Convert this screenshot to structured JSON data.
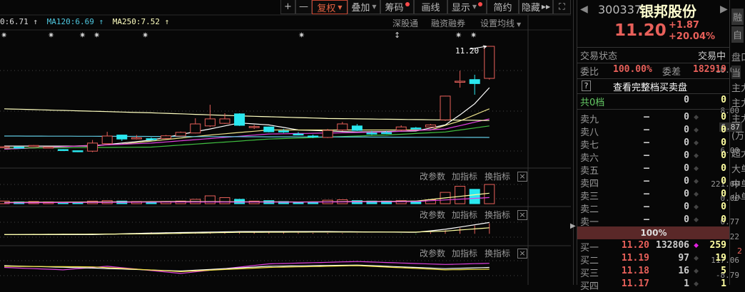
{
  "toolbar": {
    "zoom_in": "+",
    "zoom_out": "—",
    "fuquan": "复权",
    "diejia": "叠加",
    "chouma": "筹码",
    "huaxian": "画线",
    "xianshi": "显示",
    "jianyue": "简约",
    "yincang": "隐藏"
  },
  "ma_legend": [
    {
      "text": "0:6.71 ↑",
      "color": "#dddddd"
    },
    {
      "text": "MA120:6.69 ↑",
      "color": "#4fc8e0"
    },
    {
      "text": "MA250:7.52 ↑",
      "color": "#ffffc0"
    }
  ],
  "links": {
    "shengutong": "深股通",
    "rongzi": "融资融券",
    "shezhi": "设置均线"
  },
  "markers": "✷",
  "panel_tools": {
    "param": "改参数",
    "add": "加指标",
    "switch": "换指标",
    "close": "×"
  },
  "axes": {
    "main": [
      "10.00",
      "8.00",
      "6.00"
    ],
    "current": "6.87",
    "volume": [
      "221.00",
      "0.00"
    ],
    "macd": [
      "0.77",
      "-0.22"
    ],
    "ind3": [
      "117.06",
      "-8.79"
    ]
  },
  "last_price_label": "11.20",
  "colors": {
    "up": "#e8605a",
    "down": "#2ae8f0",
    "ma5": "#ffffff",
    "ma10": "#f0e68c",
    "ma20": "#e040e0",
    "ma60": "#40c040",
    "ma120": "#60c8e0",
    "ma250": "#ffffc0"
  },
  "chart_data": {
    "type": "candlestick",
    "ylim": [
      5.6,
      11.5
    ],
    "ohlc": [
      [
        6.2,
        6.22,
        6.25,
        6.18
      ],
      [
        6.2,
        6.18,
        6.22,
        6.15
      ],
      [
        6.22,
        6.28,
        6.3,
        6.2
      ],
      [
        6.18,
        6.2,
        6.22,
        6.15
      ],
      [
        6.08,
        6.03,
        6.1,
        6.0
      ],
      [
        6.02,
        5.98,
        6.03,
        5.95
      ],
      [
        6.0,
        6.4,
        6.55,
        5.95
      ],
      [
        6.37,
        6.75,
        6.96,
        6.33
      ],
      [
        6.8,
        6.6,
        6.82,
        6.5
      ],
      [
        6.64,
        6.66,
        6.8,
        6.58
      ],
      [
        6.62,
        6.6,
        6.68,
        6.55
      ],
      [
        6.63,
        6.76,
        6.8,
        6.6
      ],
      [
        6.75,
        6.93,
        6.97,
        6.72
      ],
      [
        6.9,
        7.35,
        7.63,
        6.88
      ],
      [
        7.25,
        7.6,
        8.3,
        7.2
      ],
      [
        7.38,
        7.6,
        7.88,
        7.35
      ],
      [
        7.85,
        7.28,
        7.88,
        7.25
      ],
      [
        7.18,
        7.22,
        7.3,
        7.1
      ],
      [
        7.2,
        6.96,
        7.22,
        6.93
      ],
      [
        7.0,
        6.98,
        7.1,
        6.9
      ],
      [
        6.85,
        6.83,
        6.95,
        6.78
      ],
      [
        6.75,
        6.73,
        6.82,
        6.65
      ],
      [
        6.68,
        7.03,
        7.1,
        6.65
      ],
      [
        7.05,
        7.35,
        7.45,
        7.0
      ],
      [
        7.25,
        7.03,
        7.35,
        7.0
      ],
      [
        6.9,
        6.88,
        7.0,
        6.8
      ],
      [
        6.92,
        6.9,
        7.0,
        6.85
      ],
      [
        7.05,
        7.2,
        7.28,
        7.0
      ],
      [
        7.15,
        7.12,
        7.2,
        7.08
      ],
      [
        7.2,
        7.3,
        7.35,
        7.15
      ],
      [
        7.55,
        8.73,
        8.75,
        7.5
      ],
      [
        9.45,
        9.47,
        9.99,
        9.15
      ],
      [
        9.55,
        9.35,
        9.79,
        8.8
      ],
      [
        9.61,
        11.2,
        11.2,
        9.55
      ]
    ],
    "ma": [
      {
        "name": "MA5",
        "color": "#ffffff",
        "pts": [
          [
            0,
            6.25
          ],
          [
            6,
            6.25
          ],
          [
            10,
            6.55
          ],
          [
            14,
            7.1
          ],
          [
            16,
            7.4
          ],
          [
            18,
            7.3
          ],
          [
            20,
            7.05
          ],
          [
            24,
            6.95
          ],
          [
            28,
            7.0
          ],
          [
            30,
            7.3
          ],
          [
            31,
            7.8
          ],
          [
            32,
            8.35
          ],
          [
            33,
            9.15
          ]
        ]
      },
      {
        "name": "MA10",
        "color": "#f0e68c",
        "pts": [
          [
            0,
            6.1
          ],
          [
            8,
            6.35
          ],
          [
            14,
            6.8
          ],
          [
            18,
            7.05
          ],
          [
            24,
            7.05
          ],
          [
            29,
            7.05
          ],
          [
            31,
            7.5
          ],
          [
            33,
            8.1
          ]
        ]
      },
      {
        "name": "MA20",
        "color": "#e040e0",
        "pts": [
          [
            0,
            6.1
          ],
          [
            10,
            6.4
          ],
          [
            18,
            6.85
          ],
          [
            26,
            6.95
          ],
          [
            30,
            7.1
          ],
          [
            33,
            7.6
          ]
        ]
      },
      {
        "name": "MA60",
        "color": "#40c040",
        "pts": [
          [
            0,
            6.15
          ],
          [
            10,
            6.2
          ],
          [
            18,
            6.6
          ],
          [
            26,
            6.8
          ],
          [
            30,
            6.95
          ],
          [
            33,
            7.25
          ]
        ]
      },
      {
        "name": "MA120",
        "color": "#60c8e0",
        "pts": [
          [
            0,
            6.75
          ],
          [
            33,
            6.68
          ]
        ]
      },
      {
        "name": "MA250",
        "color": "#ffffc0",
        "pts": [
          [
            0,
            8.1
          ],
          [
            5,
            8.0
          ],
          [
            10,
            7.9
          ],
          [
            16,
            7.75
          ],
          [
            22,
            7.62
          ],
          [
            33,
            7.52
          ]
        ]
      }
    ],
    "volume": [
      30,
      20,
      25,
      20,
      15,
      15,
      30,
      35,
      30,
      25,
      20,
      25,
      30,
      50,
      90,
      70,
      50,
      30,
      35,
      25,
      20,
      15,
      40,
      45,
      35,
      30,
      30,
      35,
      30,
      45,
      130,
      200,
      165,
      221
    ],
    "volume_ylim": [
      0,
      221
    ],
    "macd": {
      "ylim": [
        -0.22,
        0.77
      ],
      "dif": [
        [
          0,
          -0.05
        ],
        [
          6,
          -0.05
        ],
        [
          10,
          0.05
        ],
        [
          16,
          0.15
        ],
        [
          22,
          0.15
        ],
        [
          28,
          0.1
        ],
        [
          30,
          0.3
        ],
        [
          33,
          0.75
        ]
      ],
      "dea": [
        [
          0,
          -0.05
        ],
        [
          10,
          0.0
        ],
        [
          16,
          0.1
        ],
        [
          22,
          0.12
        ],
        [
          28,
          0.12
        ],
        [
          30,
          0.18
        ],
        [
          33,
          0.4
        ]
      ]
    },
    "ind3": {
      "ylim": [
        -8.79,
        117.06
      ],
      "lines": [
        {
          "color": "#e040e0",
          "pts": [
            [
              0,
              60
            ],
            [
              4,
              40
            ],
            [
              7,
              70
            ],
            [
              12,
              10
            ],
            [
              18,
              90
            ],
            [
              24,
              110
            ],
            [
              30,
              85
            ],
            [
              33,
              95
            ]
          ]
        },
        {
          "color": "#ffffff",
          "pts": [
            [
              0,
              75
            ],
            [
              6,
              55
            ],
            [
              12,
              30
            ],
            [
              18,
              70
            ],
            [
              24,
              80
            ],
            [
              30,
              50
            ],
            [
              33,
              60
            ]
          ]
        },
        {
          "color": "#f0e040",
          "pts": [
            [
              0,
              70
            ],
            [
              6,
              65
            ],
            [
              12,
              25
            ],
            [
              18,
              60
            ],
            [
              24,
              75
            ],
            [
              30,
              40
            ],
            [
              33,
              45
            ]
          ]
        }
      ]
    }
  },
  "quote": {
    "code": "300337",
    "name": "银邦股份",
    "price": "11.20",
    "change": "+1.87",
    "change_pct": "+20.04%",
    "status_label": "交易状态",
    "status": "交易中",
    "weibi_label": "委比",
    "weibi": "100.00%",
    "weicha_label": "委差",
    "weicha": "182919",
    "help": "?",
    "full_book": "查看完整档买卖盘",
    "total_label": "共0档",
    "total_vol": "0",
    "total_cnt": "0",
    "sells": [
      {
        "l": "卖九",
        "p": "—",
        "v": "0",
        "c": "0"
      },
      {
        "l": "卖八",
        "p": "—",
        "v": "0",
        "c": "0"
      },
      {
        "l": "卖七",
        "p": "—",
        "v": "0",
        "c": "0"
      },
      {
        "l": "卖六",
        "p": "—",
        "v": "0",
        "c": "0"
      },
      {
        "l": "卖五",
        "p": "—",
        "v": "0",
        "c": "0"
      },
      {
        "l": "卖四",
        "p": "—",
        "v": "0",
        "c": "0"
      },
      {
        "l": "卖三",
        "p": "—",
        "v": "0",
        "c": "0"
      },
      {
        "l": "卖二",
        "p": "—",
        "v": "0",
        "c": "0"
      },
      {
        "l": "卖一",
        "p": "—",
        "v": "0",
        "c": "0"
      }
    ],
    "ratio": "100%",
    "buys": [
      {
        "l": "买一",
        "p": "11.20",
        "v": "132806",
        "c": "259"
      },
      {
        "l": "买二",
        "p": "11.19",
        "v": "97",
        "c": "19"
      },
      {
        "l": "买三",
        "p": "11.18",
        "v": "16",
        "c": "5"
      },
      {
        "l": "买四",
        "p": "11.17",
        "v": "1",
        "c": "1"
      }
    ]
  },
  "side": {
    "items": [
      "融",
      "自",
      "盘口",
      "当",
      "主力",
      "主力",
      "主力",
      "(万元",
      "超大",
      "大单",
      "中单",
      "小单",
      "2"
    ]
  }
}
